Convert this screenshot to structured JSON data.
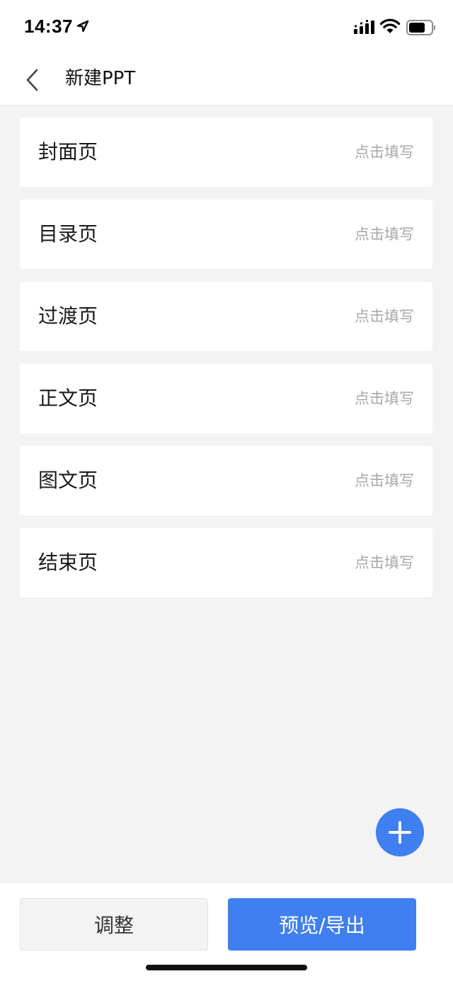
{
  "status_bar": {
    "time": "14:37"
  },
  "nav": {
    "title": "新建PPT"
  },
  "pages": [
    {
      "label": "封面页",
      "hint": "点击填写"
    },
    {
      "label": "目录页",
      "hint": "点击填写"
    },
    {
      "label": "过渡页",
      "hint": "点击填写"
    },
    {
      "label": "正文页",
      "hint": "点击填写"
    },
    {
      "label": "图文页",
      "hint": "点击填写"
    },
    {
      "label": "结束页",
      "hint": "点击填写"
    }
  ],
  "footer": {
    "adjust_label": "调整",
    "preview_label": "预览/导出"
  },
  "colors": {
    "accent": "#3f7ff0",
    "background": "#f3f3f3",
    "hint": "#a8a8a8"
  },
  "icons": {
    "back": "chevron-left-icon",
    "add": "plus-icon",
    "location": "location-arrow-icon",
    "signal": "cellular-signal-icon",
    "wifi": "wifi-icon",
    "battery": "battery-icon"
  }
}
